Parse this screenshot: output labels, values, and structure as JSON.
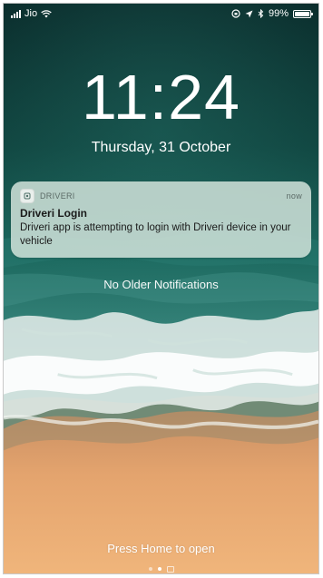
{
  "status_bar": {
    "carrier": "Jio",
    "battery": "99%",
    "signal_icon": "cellular-signal-icon",
    "wifi_icon": "wifi-icon",
    "lock_icon": "orientation-lock-icon",
    "location_icon": "location-arrow-icon",
    "bluetooth_icon": "bluetooth-icon",
    "battery_icon": "battery-icon"
  },
  "lock_screen": {
    "time": "11:24",
    "date": "Thursday, 31 October",
    "no_older": "No Older Notifications",
    "press_home": "Press Home to open"
  },
  "notification": {
    "app_name": "DRIVERI",
    "time": "now",
    "title": "Driveri Login",
    "body": "Driveri app is attempting to login with Driveri device in your vehicle",
    "icon": "driveri-app-icon"
  },
  "page_indicator": {
    "count": 3,
    "active_index": 1
  },
  "colors": {
    "notification_bg": "#d0e2da",
    "ocean": "#0e3b38",
    "sand": "#e4a36b"
  }
}
